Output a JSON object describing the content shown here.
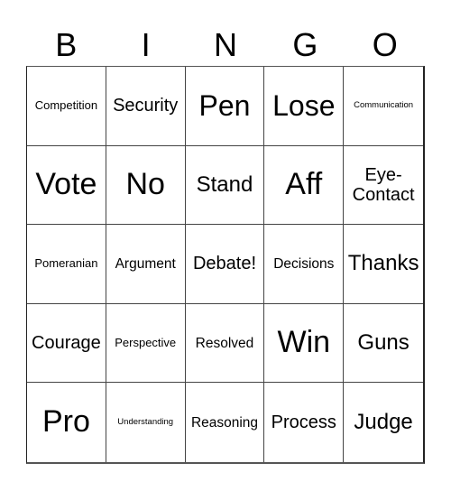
{
  "header": {
    "letters": [
      "B",
      "I",
      "N",
      "G",
      "O"
    ]
  },
  "card": {
    "rows": [
      [
        "Competition",
        "Security",
        "Pen",
        "Lose",
        "Communication"
      ],
      [
        "Vote",
        "No",
        "Stand",
        "Aff",
        "Eye-\nContact"
      ],
      [
        "Pomeranian",
        "Argument",
        "Debate!",
        "Decisions",
        "Thanks"
      ],
      [
        "Courage",
        "Perspective",
        "Resolved",
        "Win",
        "Guns"
      ],
      [
        "Pro",
        "Understanding",
        "Reasoning",
        "Process",
        "Judge"
      ]
    ]
  }
}
